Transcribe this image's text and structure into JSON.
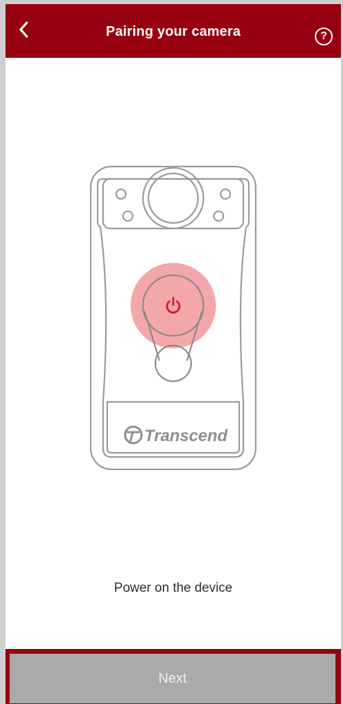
{
  "header": {
    "title": "Pairing your camera",
    "back_icon": "chevron-left-icon",
    "help_icon": "question-circle-icon",
    "help_symbol": "?"
  },
  "illustration": {
    "brand": "Transcend",
    "power_icon": "power-icon",
    "highlight_color": "#F08A8E",
    "power_color": "#D0222B"
  },
  "instruction": {
    "text": "Power on the device"
  },
  "footer": {
    "next_label": "Next"
  },
  "colors": {
    "brand": "#970011",
    "disabled_button": "#AAAAAA"
  }
}
